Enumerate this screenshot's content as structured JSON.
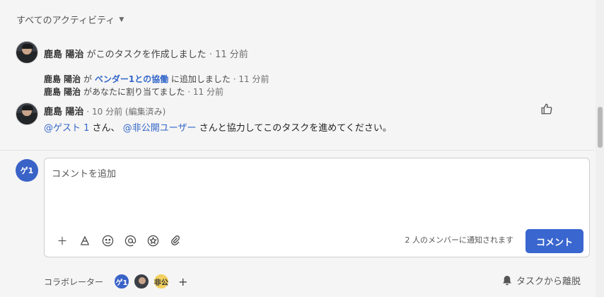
{
  "filter": {
    "label": "すべてのアクティビティ",
    "chevron_icon": "chevron-down-icon"
  },
  "activity": [
    {
      "author": "鹿島 陽治",
      "text": "がこのタスクを作成しました",
      "time": "· 11 分前"
    },
    {
      "author": "鹿島 陽治",
      "text": "が",
      "link": "ベンダー1との協働",
      "text2": "に追加しました",
      "time": "· 11 分前"
    },
    {
      "author": "鹿島 陽治",
      "text": "があなたに割り当てました",
      "time": "· 11 分前"
    }
  ],
  "comment": {
    "author": "鹿島 陽治",
    "meta": "· 10 分前 (編集済み)",
    "mention1": "@ゲスト 1",
    "text1": "さん、",
    "mention2": "@非公開ユーザー",
    "text2": "さんと協力してこのタスクを進めてください。",
    "like_icon": "thumbs-up-icon"
  },
  "composer": {
    "avatar_label": "ゲ1",
    "placeholder": "コメントを追加",
    "notify_text": "2 人のメンバーに通知されます",
    "submit_label": "コメント",
    "tools": [
      "plus-icon",
      "text-format-icon",
      "emoji-icon",
      "mention-icon",
      "star-icon",
      "paperclip-icon"
    ]
  },
  "collaborators": {
    "label": "コラボレーター",
    "members": [
      "ゲ1",
      "",
      "非公"
    ],
    "add_label": "+"
  },
  "leave": {
    "label": "タスクから離脱",
    "bell_icon": "bell-icon"
  }
}
